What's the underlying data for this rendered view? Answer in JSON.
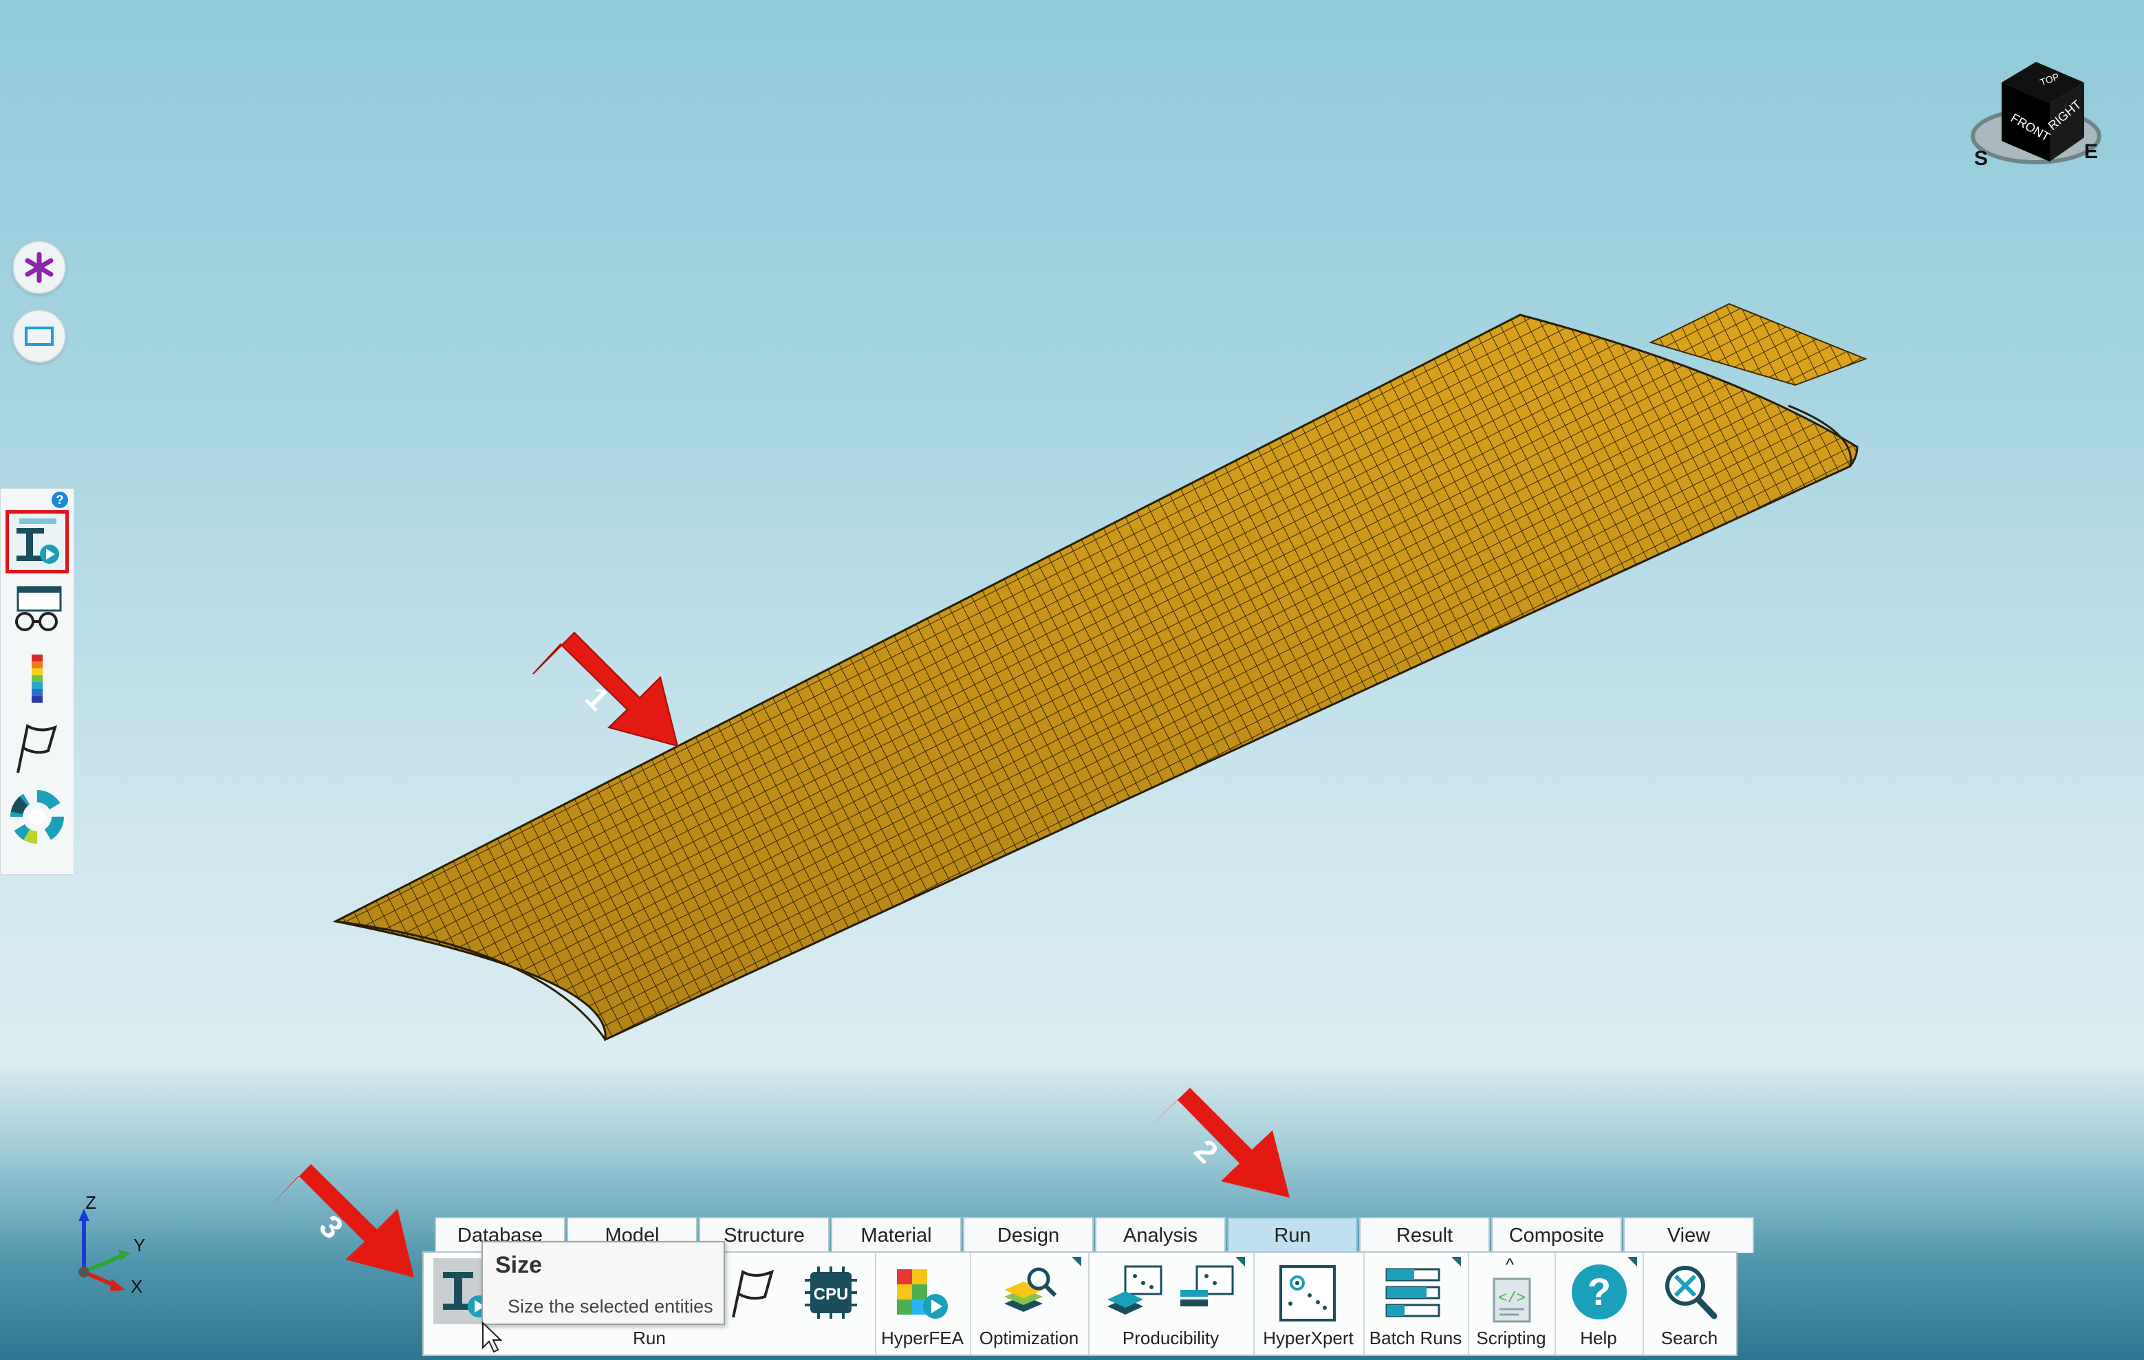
{
  "view_cube": {
    "faces": [
      "TOP",
      "FRONT",
      "RIGHT"
    ],
    "compass": [
      "S",
      "E"
    ]
  },
  "left_float": [
    {
      "name": "snap-icon"
    },
    {
      "name": "rectangle-icon"
    }
  ],
  "left_toolbar": {
    "help": "?",
    "items": [
      "size-run-icon",
      "viewer-glasses-icon",
      "legend-color-icon",
      "flag-icon",
      "color-wheel-icon"
    ]
  },
  "tabs": [
    "Database",
    "Model",
    "Structure",
    "Material",
    "Design",
    "Analysis",
    "Run",
    "Result",
    "Composite",
    "View"
  ],
  "active_tab": "Run",
  "ribbon": {
    "run_group": "Run",
    "hyperfea": "HyperFEA",
    "optimization": "Optimization",
    "producibility": "Producibility",
    "hyperxpert": "HyperXpert",
    "batch_runs": "Batch Runs",
    "scripting": "Scripting",
    "help": "Help",
    "search": "Search",
    "cpu_label": "CPU"
  },
  "tooltip": {
    "title": "Size",
    "description": "Size the selected entities"
  },
  "annotations": [
    "1",
    "2",
    "3"
  ],
  "axis": {
    "z": "Z",
    "y": "Y",
    "x": "X"
  },
  "colors": {
    "mesh_fill": "#d9a11c",
    "mesh_line": "#3a2a05",
    "highlight": "#e0121a",
    "accent": "#1aa0b8"
  }
}
